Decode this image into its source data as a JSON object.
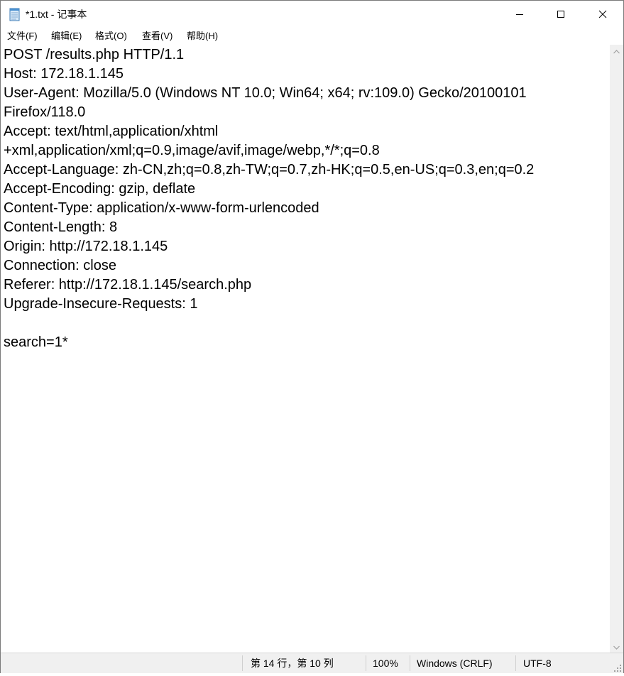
{
  "window": {
    "title": "*1.txt - 记事本"
  },
  "menu": [
    {
      "label": "文件(F)"
    },
    {
      "label": "编辑(E)"
    },
    {
      "label": "格式(O)"
    },
    {
      "label": "查看(V)"
    },
    {
      "label": "帮助(H)"
    }
  ],
  "editor": {
    "lines": [
      "POST /results.php HTTP/1.1",
      "Host: 172.18.1.145",
      "User-Agent: Mozilla/5.0 (Windows NT 10.0; Win64; x64; rv:109.0) Gecko/20100101",
      "Firefox/118.0",
      "Accept: text/html,application/xhtml",
      "+xml,application/xml;q=0.9,image/avif,image/webp,*/*;q=0.8",
      "Accept-Language: zh-CN,zh;q=0.8,zh-TW;q=0.7,zh-HK;q=0.5,en-US;q=0.3,en;q=0.2",
      "Accept-Encoding: gzip, deflate",
      "Content-Type: application/x-www-form-urlencoded",
      "Content-Length: 8",
      "Origin: http://172.18.1.145",
      "Connection: close",
      "Referer: http://172.18.1.145/search.php",
      "Upgrade-Insecure-Requests: 1",
      "",
      "search=1*"
    ]
  },
  "status": {
    "position": "第 14 行，第 10 列",
    "zoom": "100%",
    "line_ending": "Windows (CRLF)",
    "encoding": "UTF-8"
  },
  "icons": {
    "app": "notepad-icon",
    "minimize": "minimize-icon",
    "maximize": "maximize-icon",
    "close": "close-icon"
  }
}
